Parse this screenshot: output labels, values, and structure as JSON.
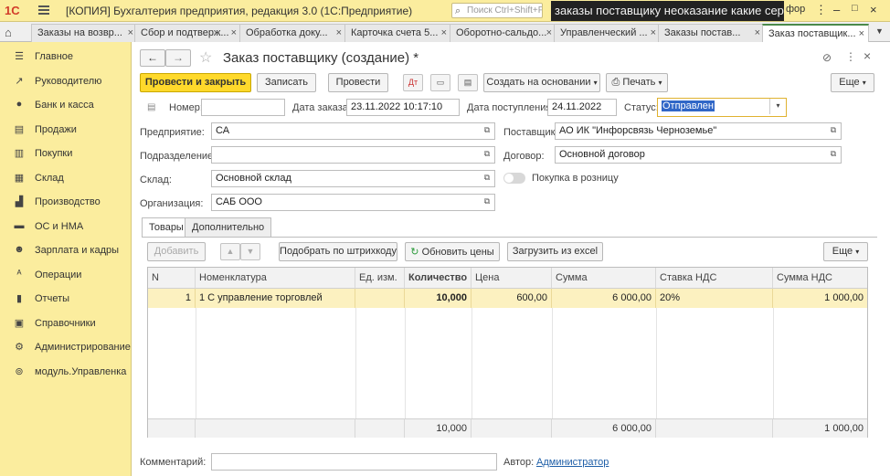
{
  "titlebar": {
    "logo": "1С",
    "title": "[КОПИЯ] Бухгалтерия предприятия, редакция 3.0  (1С:Предприятие)",
    "search_placeholder": "Поиск Ctrl+Shift+F",
    "overlay_text": "заказы поставщику неоказание какие серии",
    "right_text": "фор"
  },
  "tabs": [
    {
      "label": "Заказы на возвр..."
    },
    {
      "label": "Сбор и подтверж..."
    },
    {
      "label": "Обработка доку..."
    },
    {
      "label": "Карточка счета 5..."
    },
    {
      "label": "Оборотно-сальдо..."
    },
    {
      "label": "Управленческий ..."
    },
    {
      "label": "Заказы постав..."
    },
    {
      "label": "Заказ поставщик..."
    }
  ],
  "sidebar": {
    "items": [
      {
        "label": "Главное",
        "icon": "menu-icon"
      },
      {
        "label": "Руководителю",
        "icon": "trend-icon"
      },
      {
        "label": "Банк и касса",
        "icon": "coin-icon"
      },
      {
        "label": "Продажи",
        "icon": "cart-icon"
      },
      {
        "label": "Покупки",
        "icon": "basket-icon"
      },
      {
        "label": "Склад",
        "icon": "warehouse-icon"
      },
      {
        "label": "Производство",
        "icon": "factory-icon"
      },
      {
        "label": "ОС и НМА",
        "icon": "assets-icon"
      },
      {
        "label": "Зарплата и кадры",
        "icon": "person-icon"
      },
      {
        "label": "Операции",
        "icon": "operations-icon"
      },
      {
        "label": "Отчеты",
        "icon": "chart-icon"
      },
      {
        "label": "Справочники",
        "icon": "book-icon"
      },
      {
        "label": "Администрирование",
        "icon": "gear-icon"
      },
      {
        "label": "модуль.Управленка",
        "icon": "module-icon"
      }
    ]
  },
  "form": {
    "title": "Заказ поставщику (создание) *",
    "more_top": "⋮",
    "close": "×",
    "toolbar": {
      "post_close": "Провести и закрыть",
      "save": "Записать",
      "post": "Провести",
      "create_based": "Создать на основании",
      "print": "Печать",
      "more": "Еще"
    },
    "header": {
      "number_label": "Номер:",
      "number_value": "",
      "date_label": "Дата заказа:",
      "date_value": "23.11.2022 10:17:10",
      "receipt_label": "Дата поступления:",
      "receipt_value": "24.11.2022",
      "status_label": "Статус:",
      "status_value": "Отправлен",
      "company_label": "Предприятие:",
      "company_value": "СА",
      "supplier_label": "Поставщик:",
      "supplier_value": "АО ИК \"Инфорсвязь Черноземье\"",
      "division_label": "Подразделение:",
      "division_value": "",
      "contract_label": "Договор:",
      "contract_value": "Основной договор",
      "warehouse_label": "Склад:",
      "warehouse_value": "Основной склад",
      "retail_label": "Покупка в розницу",
      "org_label": "Организация:",
      "org_value": "САБ ООО"
    },
    "inner_tabs": [
      "Товары",
      "Дополнительно"
    ],
    "items_toolbar": {
      "add": "Добавить",
      "barcode": "Подобрать по штрихкоду",
      "refresh_prices": "Обновить цены",
      "load_excel": "Загрузить из excel",
      "more": "Еще"
    },
    "table": {
      "columns": [
        "N",
        "Номенклатура",
        "Ед. изм.",
        "Количество",
        "Цена",
        "Сумма",
        "Ставка НДС",
        "Сумма НДС"
      ],
      "rows": [
        [
          "1",
          "1 С управление торговлей",
          "",
          "10,000",
          "600,00",
          "6 000,00",
          "20%",
          "1 000,00"
        ]
      ],
      "totals": {
        "quantity": "10,000",
        "sum": "6 000,00",
        "vat_sum": "1 000,00"
      }
    },
    "footer": {
      "comment_label": "Комментарий:",
      "comment_value": "",
      "author_label": "Автор:",
      "author_value": "Администратор"
    }
  }
}
